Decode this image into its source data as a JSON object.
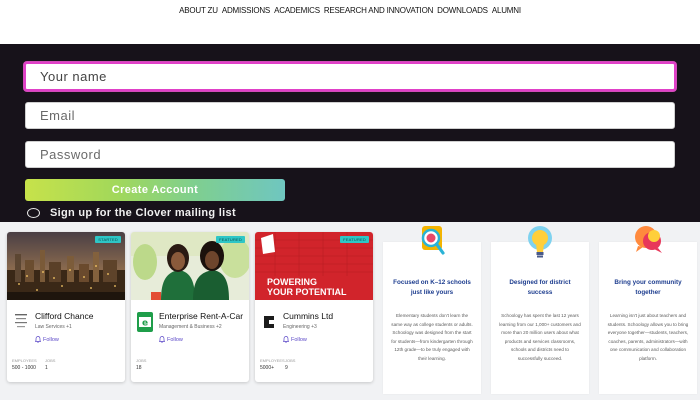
{
  "nav": {
    "items": [
      "ABOUT ZU",
      "ADMISSIONS",
      "ACADEMICS",
      "RESEARCH AND INNOVATION",
      "DOWNLOADS",
      "ALUMNI"
    ]
  },
  "signup": {
    "name_placeholder": "Your name",
    "email_placeholder": "Email",
    "password_placeholder": "Password",
    "create_label": "Create Account",
    "mailing_label": "Sign up for the Clover mailing list"
  },
  "cards": [
    {
      "badge": "STARTED",
      "name": "Clifford Chance",
      "industry": "Law Services +1",
      "follow": "Follow",
      "stat1_label": "EMPLOYEES",
      "stat1_value": "500 - 1000",
      "stat2_label": "JOBS",
      "stat2_value": "1"
    },
    {
      "badge": "FEATURED",
      "name": "Enterprise Rent-A-Car",
      "industry": "Management & Business +2",
      "follow": "Follow",
      "stat2_label": "JOBS",
      "stat2_value": "18"
    },
    {
      "badge": "FEATURED",
      "name": "Cummins Ltd",
      "industry": "Engineering +3",
      "follow": "Follow",
      "image_text": [
        "POWERING",
        "YOUR POTENTIAL"
      ],
      "stat1_label": "EMPLOYEES",
      "stat1_value": "5000+",
      "stat2_label": "JOBS",
      "stat2_value": "9"
    }
  ],
  "features": [
    {
      "icon": "magnifier-icon",
      "title": "Focused on K–12 schools just like yours",
      "body": "Elementary students don't learn the same way as college students or adults. Schoology was designed from the start for students—from kindergarten through 12th grade—to be truly engaged with their learning."
    },
    {
      "icon": "lightbulb-icon",
      "title": "Designed for district success",
      "body": "Schoology has spent the last 12 years learning from our 1,000+ customers and more than 20 million users about what products and services classrooms, schools and districts need to successfully succeed."
    },
    {
      "icon": "chat-bubbles-icon",
      "title": "Bring your community together",
      "body": "Learning isn't just about teachers and students. Schoology allows you to bring everyone together—students, teachers, coaches, parents, administrators—with one communication and collaboration platform."
    }
  ],
  "colors": {
    "dark_band": "#17121a",
    "focus_border": "#e040c8",
    "title_blue": "#1d3d8f",
    "follow_purple": "#5a47c7",
    "badge_teal": "#2ec6c6"
  }
}
